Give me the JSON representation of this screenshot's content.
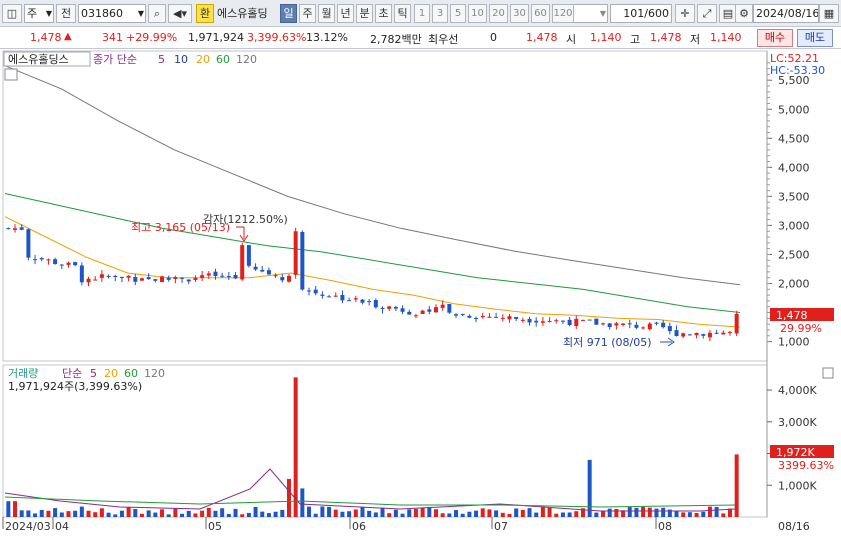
{
  "toolbar": {
    "market": "주",
    "market_toggle": "전",
    "code": "031860",
    "tag_exchange": "환",
    "stock_name": "에스유홀딩",
    "periods": [
      "일",
      "주",
      "월",
      "년",
      "분",
      "초",
      "틱"
    ],
    "active_period": "일",
    "intervals": [
      "1",
      "3",
      "5",
      "10",
      "20",
      "30",
      "60",
      "120"
    ],
    "page_count": "101/600",
    "date": "2024/08/16"
  },
  "quote": {
    "price": "1,478",
    "change": "341",
    "change_pct": "+29.99%",
    "volume": "1,971,924",
    "volume_ratio": "3,399.63%",
    "turnover": "13.12%",
    "amount": "2,782백만",
    "priority_label": "최우선",
    "priority_value": "0",
    "current": "1,478",
    "open_label": "시",
    "open": "1,140",
    "high_label": "고",
    "high": "1,478",
    "low_label": "저",
    "low": "1,140",
    "buy_label": "매수",
    "sell_label": "매도"
  },
  "price_panel": {
    "legend_name": "에스유홀딩스",
    "legend_ma_label": "종가 단순",
    "ma_periods": [
      "5",
      "10",
      "20",
      "60",
      "120"
    ],
    "lc": "LC:52.21",
    "hc": "HC:-53.30",
    "axis_ticks": [
      "5,500",
      "5,000",
      "4,500",
      "4,000",
      "3,500",
      "3,000",
      "2,500",
      "2,000",
      "1,000"
    ],
    "last_price_badge": "1,478",
    "last_pct_badge": "29.99%",
    "high_annotation": "최고 3,165 (05/13)",
    "low_annotation": "최저 971 (08/05)",
    "event_annotation": "감자(1212.50%)"
  },
  "volume_panel": {
    "legend_name": "거래량",
    "legend_ma_label": "단순",
    "ma_periods": [
      "5",
      "20",
      "60",
      "120"
    ],
    "value_line": "1,971,924주(3,399.63%)",
    "axis_ticks": [
      "4,000K",
      "3,000K",
      "2,000K",
      "1,000K"
    ],
    "last_vol_badge": "1,972K",
    "last_vol_pct": "3399.63%"
  },
  "x_axis": {
    "labels": [
      "2024/03",
      "04",
      "05",
      "06",
      "07",
      "08"
    ],
    "right_label": "08/16"
  },
  "colors": {
    "up": "#e0201c",
    "down": "#1e56c8",
    "ma5": "#8a2a8f",
    "ma10": "#1f3aa8",
    "ma20": "#f0a000",
    "ma60": "#1f9a3a",
    "ma120": "#777777"
  },
  "chart_data": [
    {
      "type": "candlestick",
      "title": "에스유홀딩스",
      "x": [
        "2024/03",
        "04",
        "05",
        "06",
        "07",
        "08",
        "08/16"
      ],
      "y_range": [
        700,
        5900
      ],
      "series": [
        {
          "name": "120",
          "values": [
            5750,
            5350,
            4800,
            4300,
            3900,
            3500,
            3200,
            2950,
            2750,
            2560,
            2400,
            2250,
            2100,
            1980
          ]
        },
        {
          "name": "60",
          "values": [
            3550,
            3350,
            3150,
            2950,
            2800,
            2650,
            2550,
            2400,
            2250,
            2100,
            2000,
            1900,
            1750,
            1600,
            1500
          ]
        },
        {
          "name": "20",
          "values": [
            3150,
            2800,
            2450,
            2180,
            2100,
            2100,
            2100,
            2180,
            2050,
            1900,
            1800,
            1650,
            1560,
            1480,
            1450,
            1400,
            1380,
            1300,
            1250
          ]
        }
      ],
      "annotations": [
        "최고 3,165 (05/13)",
        "최저 971 (08/05)",
        "감자(1212.50%)"
      ]
    },
    {
      "type": "bar",
      "title": "거래량",
      "highlights": [
        {
          "label": "05/13",
          "value": 4400000
        },
        {
          "label": "08/16",
          "value": 1971924
        }
      ],
      "y_range": [
        0,
        4600000
      ]
    }
  ]
}
